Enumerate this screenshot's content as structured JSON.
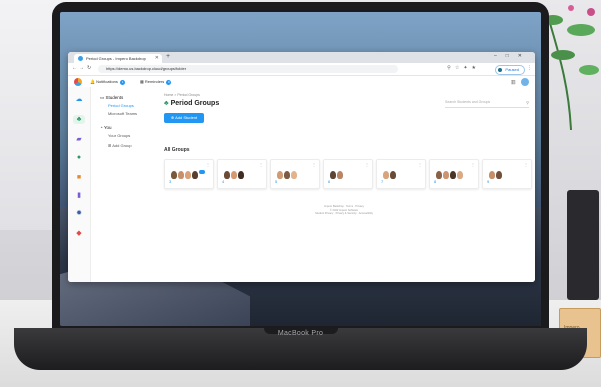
{
  "scene": {
    "device_label": "MacBook Pro"
  },
  "browser": {
    "tab_title": "Period Groups - Impero Backdrop",
    "url": "https://demo.us.backdrop.cloud/groups/folder",
    "profile_status": "Paused"
  },
  "app": {
    "nav": {
      "notifications": "Notifications",
      "notifications_count": "1",
      "reminders": "Reminders",
      "reminders_count": "0"
    },
    "subnav": {
      "students_heading": "Students",
      "period_groups": "Period Groups",
      "microsoft_teams": "Microsoft Teams",
      "you_heading": "You",
      "your_groups": "Your Groups",
      "add_group": "Add Group"
    },
    "breadcrumb": "Home > Period Groups",
    "page_title": "Period Groups",
    "search_placeholder": "Search Students and Groups",
    "add_student_label": "Add Student",
    "section_title": "All Groups",
    "groups": [
      {
        "label": "3",
        "face_colors": [
          "#7a5a3a",
          "#c98f6b",
          "#d9a27a",
          "#5a3f2e"
        ]
      },
      {
        "label": "4",
        "face_colors": [
          "#6b4a36",
          "#d49b72",
          "#3f2d22"
        ]
      },
      {
        "label": "5",
        "face_colors": [
          "#cf9a74",
          "#7b5b44",
          "#e2b38f"
        ]
      },
      {
        "label": "6",
        "face_colors": [
          "#5e4636",
          "#b98563"
        ]
      },
      {
        "label": "7",
        "face_colors": [
          "#d8a47c",
          "#6a4b37"
        ]
      },
      {
        "label": "8",
        "face_colors": [
          "#8a6248",
          "#cc9470",
          "#4a3528",
          "#d9aa86"
        ]
      },
      {
        "label": "9",
        "face_colors": [
          "#c68e69",
          "#704f3b"
        ]
      }
    ],
    "footer": {
      "line1": "Impero Backdrop · Terms · Privacy",
      "line2": "© 2022 Impero Software",
      "line3": "Student Privacy · Privacy & Security · Accessibility"
    }
  },
  "colors": {
    "primary": "#2196f3",
    "active_rail": "#e3f4ec",
    "logo_green": "#2e9a6a"
  }
}
